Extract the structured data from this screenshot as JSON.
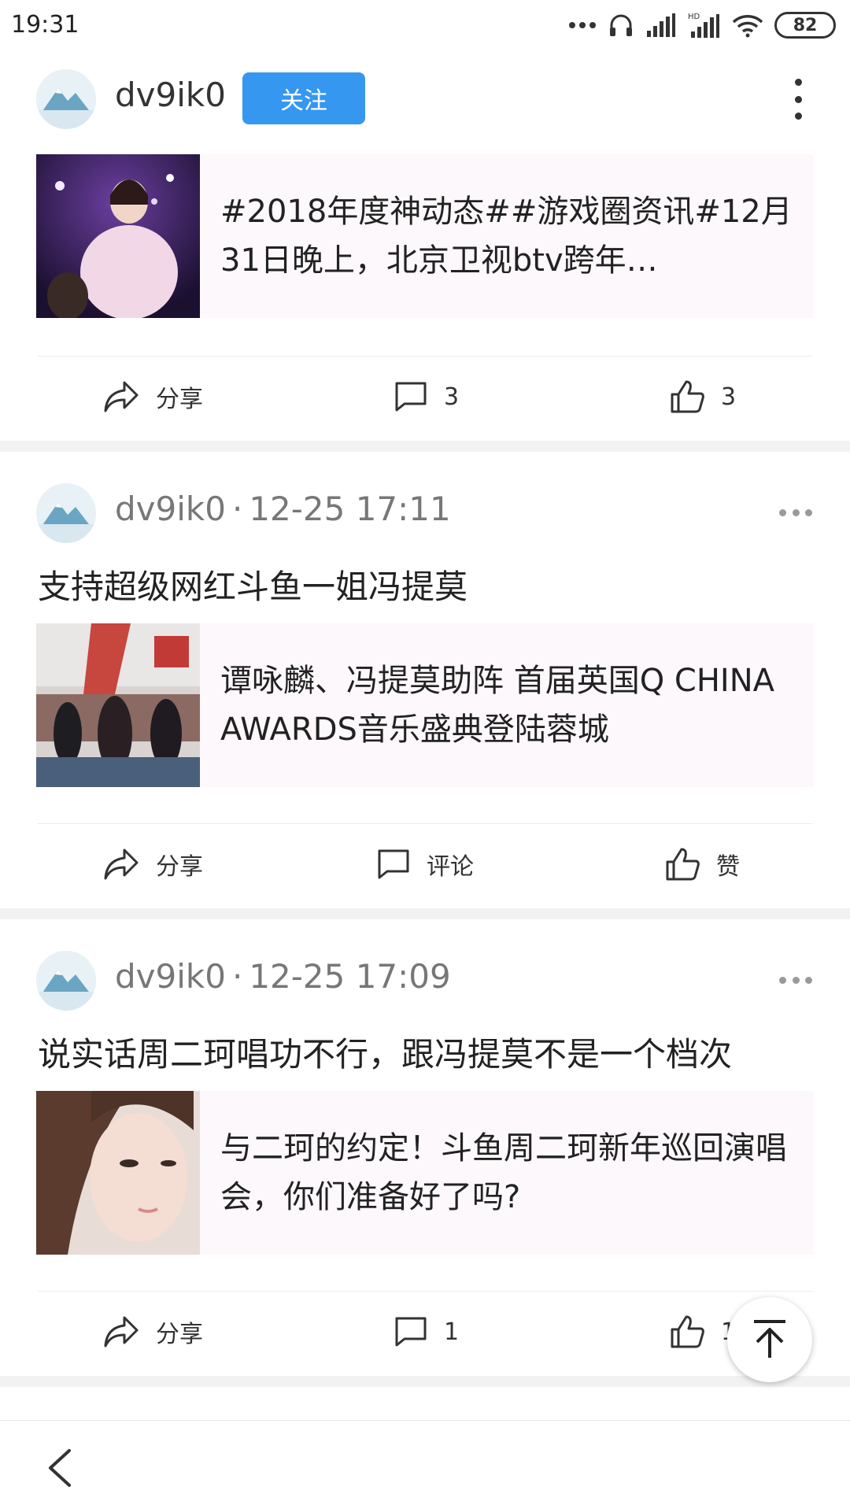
{
  "status_bar": {
    "time": "19:31",
    "battery": "82"
  },
  "header": {
    "username": "dv9ik0",
    "follow_label": "关注"
  },
  "posts": [
    {
      "card_text": "#2018年度神动态##游戏圈资讯#12月31日晚上，北京卫视btv跨年…",
      "actions": {
        "share": "分享",
        "comment": "3",
        "like": "3"
      }
    },
    {
      "username": "dv9ik0",
      "timestamp": "12-25 17:11",
      "text": "支持超级网红斗鱼一姐冯提莫",
      "card_text": "谭咏麟、冯提莫助阵 首届英国Q CHINA AWARDS音乐盛典登陆蓉城",
      "actions": {
        "share": "分享",
        "comment": "评论",
        "like": "赞"
      }
    },
    {
      "username": "dv9ik0",
      "timestamp": "12-25 17:09",
      "text": "说实话周二珂唱功不行，跟冯提莫不是一个档次",
      "card_text": "与二珂的约定！斗鱼周二珂新年巡回演唱会，你们准备好了吗?",
      "actions": {
        "share": "分享",
        "comment": "1",
        "like": "1"
      }
    }
  ],
  "separator_dot": "·",
  "icons": [
    "wifi-icon",
    "signal-icon",
    "headphones-icon",
    "share-icon",
    "comment-icon",
    "like-icon",
    "more-icon",
    "arrow-up-icon",
    "back-icon"
  ]
}
